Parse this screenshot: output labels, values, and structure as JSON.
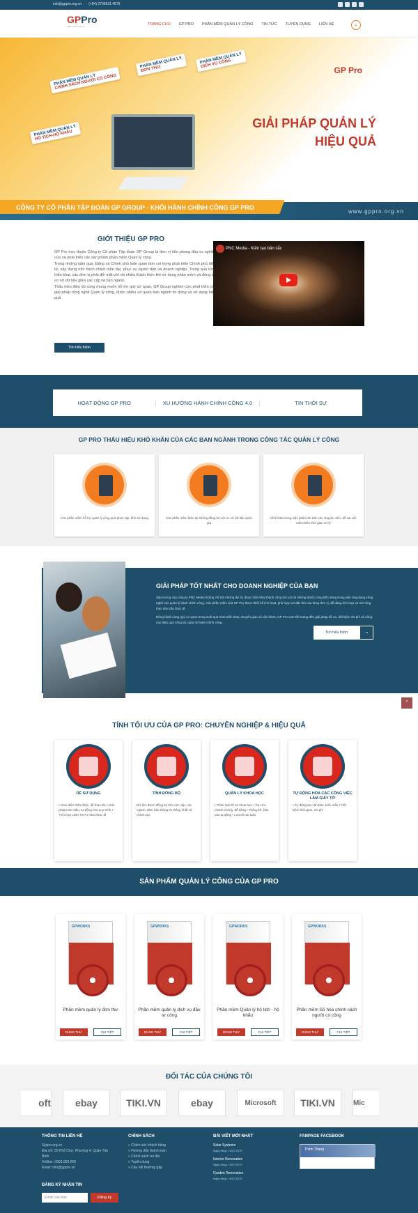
{
  "topbar": {
    "email": "info@gppro.org.vn",
    "phone": "(+84) 2706631 4579"
  },
  "header": {
    "logo_text": "GP",
    "logo_text2": "Pro",
    "logo_tagline": "Phần mềm quản lý",
    "nav": [
      "TRANG CHỦ",
      "GP PRO",
      "PHẦN MỀM QUẢN LÝ CÔNG",
      "TIN TỨC",
      "TUYỂN DỤNG",
      "LIÊN HỆ"
    ]
  },
  "hero": {
    "cards": [
      {
        "t1": "PHẦN MỀM QUẢN LÝ",
        "t2": "CHÍNH SÁCH NGƯỜI CÓ CÔNG"
      },
      {
        "t1": "PHẦN MỀM QUẢN LÝ",
        "t2": "ĐƠN THƯ"
      },
      {
        "t1": "PHẦN MỀM QUẢN LÝ",
        "t2": "DỊCH VỤ CÔNG"
      },
      {
        "t1": "PHẦN MỀM QUẢN LÝ",
        "t2": "HỘ TỊCH-HỘ KHẨU"
      }
    ],
    "brand": "GP Pro",
    "headline1": "GIẢI PHÁP QUẢN LÝ",
    "headline2": "HIỆU QUẢ",
    "band_text": "CÔNG TY CỔ PHẦN TẬP ĐOÀN GP GROUP - KHỐI HÀNH CHÍNH CÔNG GP PRO",
    "url": "www.gppro.org.vn"
  },
  "intro": {
    "title": "GIỚI THIỆU GP PRO",
    "p1": "GP Pro trực thuộc Công ty Cổ phần Tập đoàn GP Group là đơn vị tiên phong đầu tư nghiên cứu và phát triển các sản phẩm phần mềm Quản lý công.",
    "p2": "Trong những năm qua, Đảng và Chính phủ luôn quan tâm coi trọng phát triển Chính phủ điện tử, xây dựng nền hành chính hiện đại, phục vụ người dân và doanh nghiệp. Trong quá trình triển khai, các đơn vị phải đối mặt với rất nhiều thách thức khi sử dụng phần mềm và đồng bộ cơ sở dữ liệu giữa các cấp và ban ngành.",
    "p3": "Thấu hiểu điều đó cùng mong muốn hỗ trợ quý cơ quan, GP Group nghiên cứu phát triển các giải pháp công nghệ Quản lý công, được nhiều cơ quan ban ngành tin dùng và sử dụng hiệu quả.",
    "button": "Tìm hiểu thêm",
    "video_title": "PNC Media - Kiến tạo bản sắc"
  },
  "tabs": [
    "HOẠT ĐỘNG GP PRO",
    "XU HƯỚNG HÀNH CHÍNH CÔNG 4.0",
    "TIN THỜI SỰ"
  ],
  "difficulties": {
    "title": "GP PRO THẤU HIỂU KHÓ KHĂN CỦA CÁC BAN NGÀNH TRONG CÔNG TÁC QUẢN LÝ CÔNG",
    "items": [
      "Các phần mềm hỗ trợ quản lý công quá phức tạp, khó sử dụng",
      "Các phần mềm hiện tại không đồng bộ với cơ sở dữ liệu quốc gia",
      "Khó khăn trong việc phân tán trên các chuyên viên, dễ sai sót, mất nhiều thời gian xử lý"
    ]
  },
  "solution": {
    "title": "GIẢI PHÁP TỐT NHẤT CHO DOANH NGHIỆP CỦA BẠN",
    "p1": "Sản lượng của công ty PNC Media không chỉ bởi những dự án được triển khai thành công mà còn là những thành công bền vững trong việc ứng dụng công nghệ vào quản lý hành chính công. Các phần mềm của GP Pro được thiết kế linh hoạt, phù hợp với đặc thù của từng đơn vị, dễ dàng tích hợp và mở rộng theo nhu cầu thực tế.",
    "p2": "Đồng hành cùng quý cơ quan trong suốt quá trình triển khai, chuyển giao và vận hành, GP Pro cam kết mang đến giải pháp tối ưu, tiết kiệm chi phí và nâng cao hiệu quả công tác quản lý hành chính công.",
    "more": "Tìm hiểu thêm",
    "arrow": "→"
  },
  "optimal": {
    "title": "TÍNH TỐI ƯU CỦA GP PRO: CHUYÊN NGHIỆP & HIỆU QUẢ",
    "items": [
      {
        "title": "DỄ SỬ DỤNG",
        "text": "• Giao diện thân thiện, dễ thao tác • Giải pháp toàn diện, tự động hóa quy trình • Tích hợp LINH HOẠT theo thực tế"
      },
      {
        "title": "TÍNH ĐỒNG BỘ",
        "text": "Dữ liệu được đồng bộ trên các cấp, các ngành, đảm bảo thông tin thống nhất và chính xác."
      },
      {
        "title": "QUẢN LÝ KHOA HỌC",
        "text": "• Phân loại hồ sơ khoa học • Tra cứu nhanh chóng, dễ dàng • Thống kê, báo cáo tự động • Lưu trữ an toàn"
      },
      {
        "title": "TỰ ĐỘNG HÓA CÁC CÔNG VIỆC LÀM GIẤY TỜ",
        "text": "• Tự động tạo văn bản, biểu mẫu • Tiết kiệm thời gian, chi phí"
      }
    ]
  },
  "products": {
    "title": "SẢN PHẨM QUẢN LÝ CÔNG CỦA GP PRO",
    "items": [
      {
        "name": "Phần mềm quản lý đơn thư",
        "try": "DÙNG THỬ",
        "detail": "CHI TIẾT"
      },
      {
        "name": "Phần mềm quản lý dịch vụ đầu tư công",
        "try": "DÙNG THỬ",
        "detail": "CHI TIẾT"
      },
      {
        "name": "Phần mềm Quản lý hộ tịch - hộ khẩu",
        "try": "DÙNG THỬ",
        "detail": "CHI TIẾT"
      },
      {
        "name": "Phần mềm Số hóa chính sách người có công",
        "try": "DÙNG THỬ",
        "detail": "CHI TIẾT"
      }
    ],
    "box_brand": "GPWORKS"
  },
  "partners": {
    "title": "ĐỐI TÁC CỦA CHÚNG TÔI",
    "logos": [
      "oft",
      "ebay",
      "TIKI.VN",
      "ebay",
      "Microsoft",
      "TIKI.VN",
      "Mic"
    ]
  },
  "footer": {
    "contact_title": "THÔNG TIN LIÊN HỆ",
    "contact_lines": [
      "Gppro.org.vn",
      "Địa chỉ: 30 Phố Chợ, Phường 4, Quận Tân Bình",
      "Hotline: 0903.000.000",
      "Email: info@gppro.vn"
    ],
    "policy_title": "CHÍNH SÁCH",
    "policy_lines": [
      "» Chăm sóc khách hàng",
      "» Hướng dẫn thanh toán",
      "» Chính sách ưu đãi",
      "» Tuyển dụng",
      "» Câu hỏi thường gặp"
    ],
    "news_title": "BÀI VIẾT MỚI NHẤT",
    "news": [
      {
        "t": "Solar Systems",
        "d": "Ngày đăng: 15/07/2019"
      },
      {
        "t": "Interior Renovation",
        "d": "Ngày đăng: 15/07/2019"
      },
      {
        "t": "Garden Renovation",
        "d": "Ngày đăng: 15/07/2019"
      }
    ],
    "fb_title": "FANPAGE FACEBOOK",
    "fb_name": "Thinh Thang",
    "newsletter_title": "ĐĂNG KÝ NHẬN TIN",
    "newsletter_placeholder": "Email của bạn",
    "newsletter_button": "Đăng ký"
  }
}
